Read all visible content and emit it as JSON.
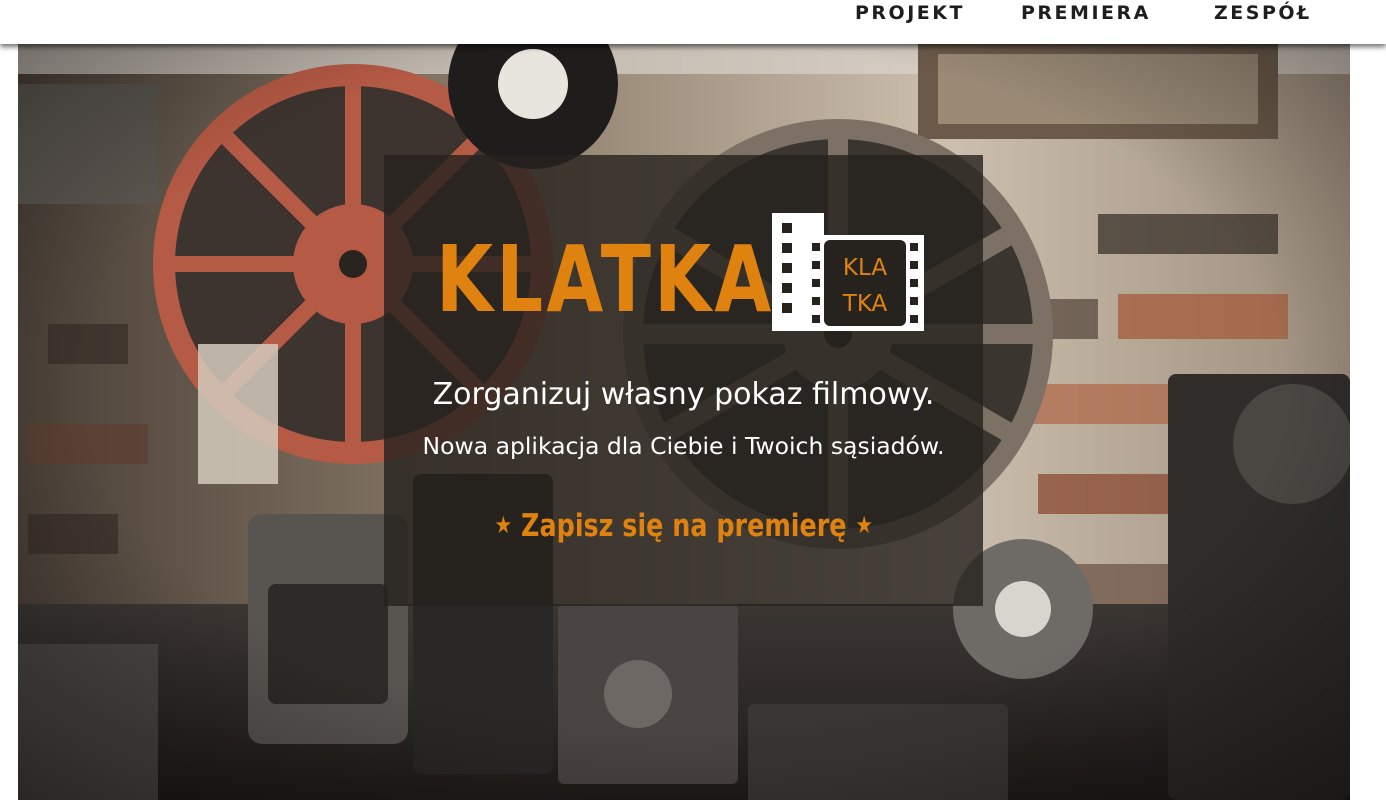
{
  "nav": {
    "items": [
      {
        "label": "PROJEKT"
      },
      {
        "label": "PREMIERA"
      },
      {
        "label": "ZESPÓŁ"
      }
    ]
  },
  "hero": {
    "brand_name": "KLATKA",
    "logo_text_line1": "KLA",
    "logo_text_line2": "TKA",
    "tagline": "Zorganizuj własny pokaz filmowy.",
    "subtagline": "Nowa aplikacja dla Ciebie i Twoich sąsiadów.",
    "cta": {
      "star_left": "★",
      "label": "Zapisz się na premierę",
      "star_right": "★"
    }
  },
  "colors": {
    "accent": "#e0820f",
    "nav_text": "#1e1e1e",
    "panel_bg": "rgba(38,34,30,0.80)"
  }
}
